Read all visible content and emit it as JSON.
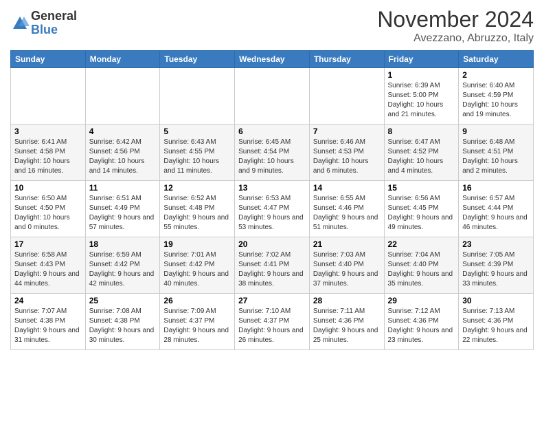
{
  "logo": {
    "general": "General",
    "blue": "Blue"
  },
  "header": {
    "month": "November 2024",
    "location": "Avezzano, Abruzzo, Italy"
  },
  "weekdays": [
    "Sunday",
    "Monday",
    "Tuesday",
    "Wednesday",
    "Thursday",
    "Friday",
    "Saturday"
  ],
  "weeks": [
    [
      {
        "day": "",
        "info": ""
      },
      {
        "day": "",
        "info": ""
      },
      {
        "day": "",
        "info": ""
      },
      {
        "day": "",
        "info": ""
      },
      {
        "day": "",
        "info": ""
      },
      {
        "day": "1",
        "info": "Sunrise: 6:39 AM\nSunset: 5:00 PM\nDaylight: 10 hours and 21 minutes."
      },
      {
        "day": "2",
        "info": "Sunrise: 6:40 AM\nSunset: 4:59 PM\nDaylight: 10 hours and 19 minutes."
      }
    ],
    [
      {
        "day": "3",
        "info": "Sunrise: 6:41 AM\nSunset: 4:58 PM\nDaylight: 10 hours and 16 minutes."
      },
      {
        "day": "4",
        "info": "Sunrise: 6:42 AM\nSunset: 4:56 PM\nDaylight: 10 hours and 14 minutes."
      },
      {
        "day": "5",
        "info": "Sunrise: 6:43 AM\nSunset: 4:55 PM\nDaylight: 10 hours and 11 minutes."
      },
      {
        "day": "6",
        "info": "Sunrise: 6:45 AM\nSunset: 4:54 PM\nDaylight: 10 hours and 9 minutes."
      },
      {
        "day": "7",
        "info": "Sunrise: 6:46 AM\nSunset: 4:53 PM\nDaylight: 10 hours and 6 minutes."
      },
      {
        "day": "8",
        "info": "Sunrise: 6:47 AM\nSunset: 4:52 PM\nDaylight: 10 hours and 4 minutes."
      },
      {
        "day": "9",
        "info": "Sunrise: 6:48 AM\nSunset: 4:51 PM\nDaylight: 10 hours and 2 minutes."
      }
    ],
    [
      {
        "day": "10",
        "info": "Sunrise: 6:50 AM\nSunset: 4:50 PM\nDaylight: 10 hours and 0 minutes."
      },
      {
        "day": "11",
        "info": "Sunrise: 6:51 AM\nSunset: 4:49 PM\nDaylight: 9 hours and 57 minutes."
      },
      {
        "day": "12",
        "info": "Sunrise: 6:52 AM\nSunset: 4:48 PM\nDaylight: 9 hours and 55 minutes."
      },
      {
        "day": "13",
        "info": "Sunrise: 6:53 AM\nSunset: 4:47 PM\nDaylight: 9 hours and 53 minutes."
      },
      {
        "day": "14",
        "info": "Sunrise: 6:55 AM\nSunset: 4:46 PM\nDaylight: 9 hours and 51 minutes."
      },
      {
        "day": "15",
        "info": "Sunrise: 6:56 AM\nSunset: 4:45 PM\nDaylight: 9 hours and 49 minutes."
      },
      {
        "day": "16",
        "info": "Sunrise: 6:57 AM\nSunset: 4:44 PM\nDaylight: 9 hours and 46 minutes."
      }
    ],
    [
      {
        "day": "17",
        "info": "Sunrise: 6:58 AM\nSunset: 4:43 PM\nDaylight: 9 hours and 44 minutes."
      },
      {
        "day": "18",
        "info": "Sunrise: 6:59 AM\nSunset: 4:42 PM\nDaylight: 9 hours and 42 minutes."
      },
      {
        "day": "19",
        "info": "Sunrise: 7:01 AM\nSunset: 4:42 PM\nDaylight: 9 hours and 40 minutes."
      },
      {
        "day": "20",
        "info": "Sunrise: 7:02 AM\nSunset: 4:41 PM\nDaylight: 9 hours and 38 minutes."
      },
      {
        "day": "21",
        "info": "Sunrise: 7:03 AM\nSunset: 4:40 PM\nDaylight: 9 hours and 37 minutes."
      },
      {
        "day": "22",
        "info": "Sunrise: 7:04 AM\nSunset: 4:40 PM\nDaylight: 9 hours and 35 minutes."
      },
      {
        "day": "23",
        "info": "Sunrise: 7:05 AM\nSunset: 4:39 PM\nDaylight: 9 hours and 33 minutes."
      }
    ],
    [
      {
        "day": "24",
        "info": "Sunrise: 7:07 AM\nSunset: 4:38 PM\nDaylight: 9 hours and 31 minutes."
      },
      {
        "day": "25",
        "info": "Sunrise: 7:08 AM\nSunset: 4:38 PM\nDaylight: 9 hours and 30 minutes."
      },
      {
        "day": "26",
        "info": "Sunrise: 7:09 AM\nSunset: 4:37 PM\nDaylight: 9 hours and 28 minutes."
      },
      {
        "day": "27",
        "info": "Sunrise: 7:10 AM\nSunset: 4:37 PM\nDaylight: 9 hours and 26 minutes."
      },
      {
        "day": "28",
        "info": "Sunrise: 7:11 AM\nSunset: 4:36 PM\nDaylight: 9 hours and 25 minutes."
      },
      {
        "day": "29",
        "info": "Sunrise: 7:12 AM\nSunset: 4:36 PM\nDaylight: 9 hours and 23 minutes."
      },
      {
        "day": "30",
        "info": "Sunrise: 7:13 AM\nSunset: 4:36 PM\nDaylight: 9 hours and 22 minutes."
      }
    ]
  ]
}
